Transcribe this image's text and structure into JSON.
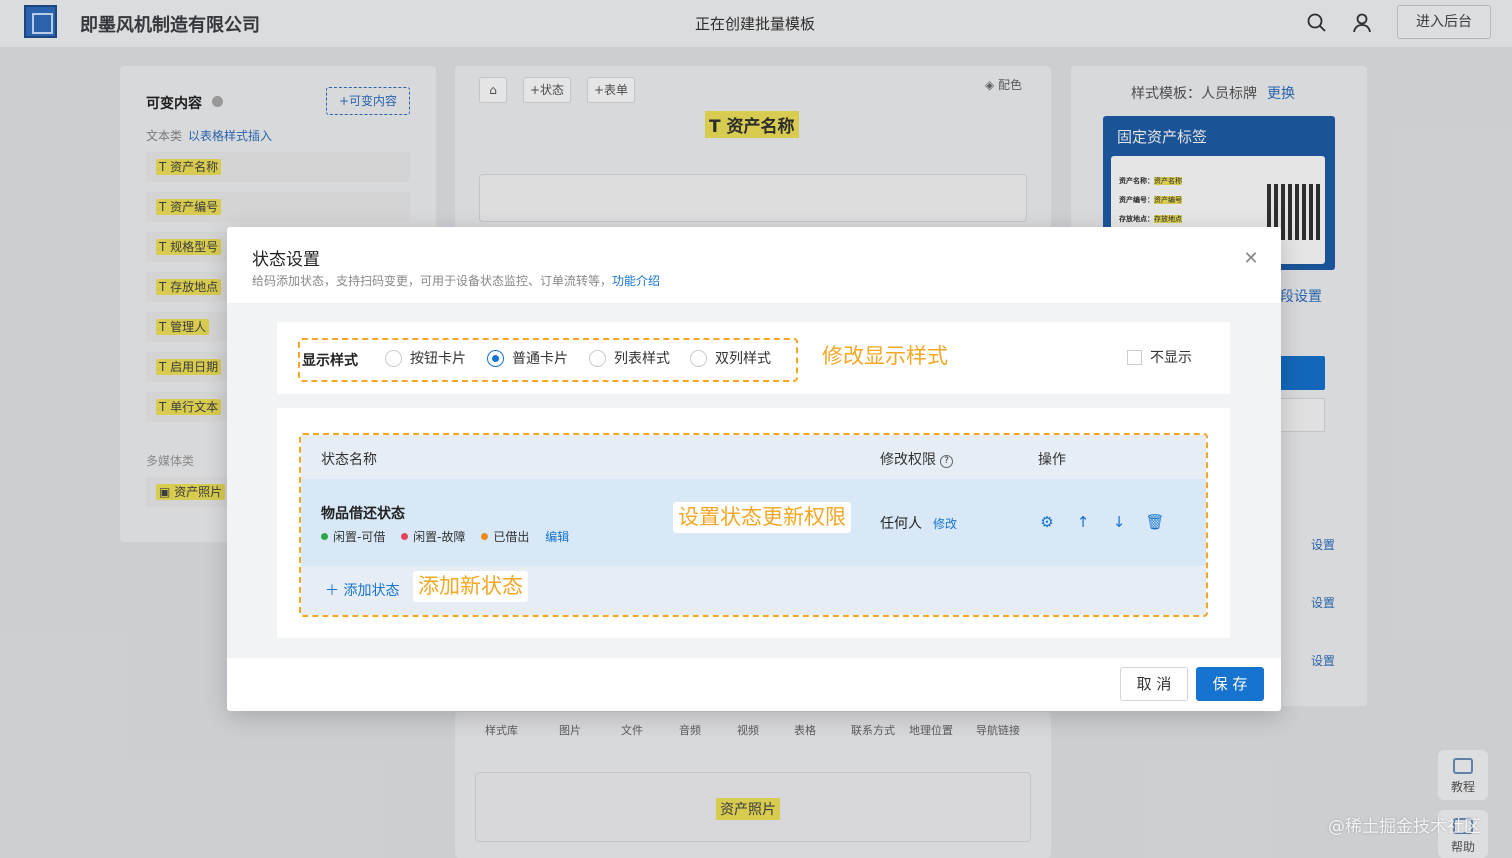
{
  "topbar": {
    "company": "即墨风机制造有限公司",
    "title": "正在创建批量模板",
    "enter_label": "进入后台"
  },
  "left_panel": {
    "title": "可变内容",
    "add_button": "+可变内容",
    "text_category": "文本类",
    "insert_link": "以表格样式插入",
    "items": [
      "资产名称",
      "资产编号",
      "规格型号",
      "存放地点",
      "管理人",
      "启用日期",
      "单行文本"
    ],
    "media_category": "多媒体类",
    "media_items": [
      "资产照片"
    ]
  },
  "canvas": {
    "tool_state": "+状态",
    "tool_form": "+表单",
    "color_label": "配色",
    "asset_title": "资产名称",
    "bottom_tabs": [
      "样式库",
      "图片",
      "文件",
      "音频",
      "视频",
      "表格",
      "联系方式",
      "地理位置",
      "导航链接"
    ],
    "photo_slot": "资产照片"
  },
  "right_panel": {
    "style_template": "样式模板：人员标牌",
    "change_link": "更换",
    "label_title": "固定资产标签",
    "label_rows": [
      {
        "k": "资产名称：",
        "v": "资产名称"
      },
      {
        "k": "资产编号：",
        "v": "资产编号"
      },
      {
        "k": "存放地点：",
        "v": "存放地点"
      }
    ],
    "field_settings": "段设置",
    "settings": [
      "设置",
      "设置",
      "设置"
    ]
  },
  "side_help": {
    "tutorial": "教程",
    "help": "帮助"
  },
  "watermark": "@稀土掘金技术社区",
  "modal": {
    "title": "状态设置",
    "desc": "给码添加状态，支持扫码变更，可用于设备状态监控、订单流转等，",
    "desc_link": "功能介绍",
    "display_style": {
      "label": "显示样式",
      "options": [
        "按钮卡片",
        "普通卡片",
        "列表样式",
        "双列样式"
      ],
      "selected": "普通卡片",
      "no_display": "不显示"
    },
    "annotations": {
      "style": "修改显示样式",
      "permission": "设置状态更新权限",
      "add": "添加新状态"
    },
    "table": {
      "headers": {
        "name": "状态名称",
        "permission": "修改权限",
        "ops": "操作"
      },
      "rows": [
        {
          "name": "物品借还状态",
          "tags": [
            {
              "label": "闲置-可借",
              "color": "#2ea64b"
            },
            {
              "label": "闲置-故障",
              "color": "#e5435b"
            },
            {
              "label": "已借出",
              "color": "#f08a1c"
            }
          ],
          "edit": "编辑",
          "permission": "任何人",
          "permission_edit": "修改"
        }
      ],
      "add_state": "添加状态"
    },
    "cancel": "取 消",
    "save": "保 存"
  }
}
